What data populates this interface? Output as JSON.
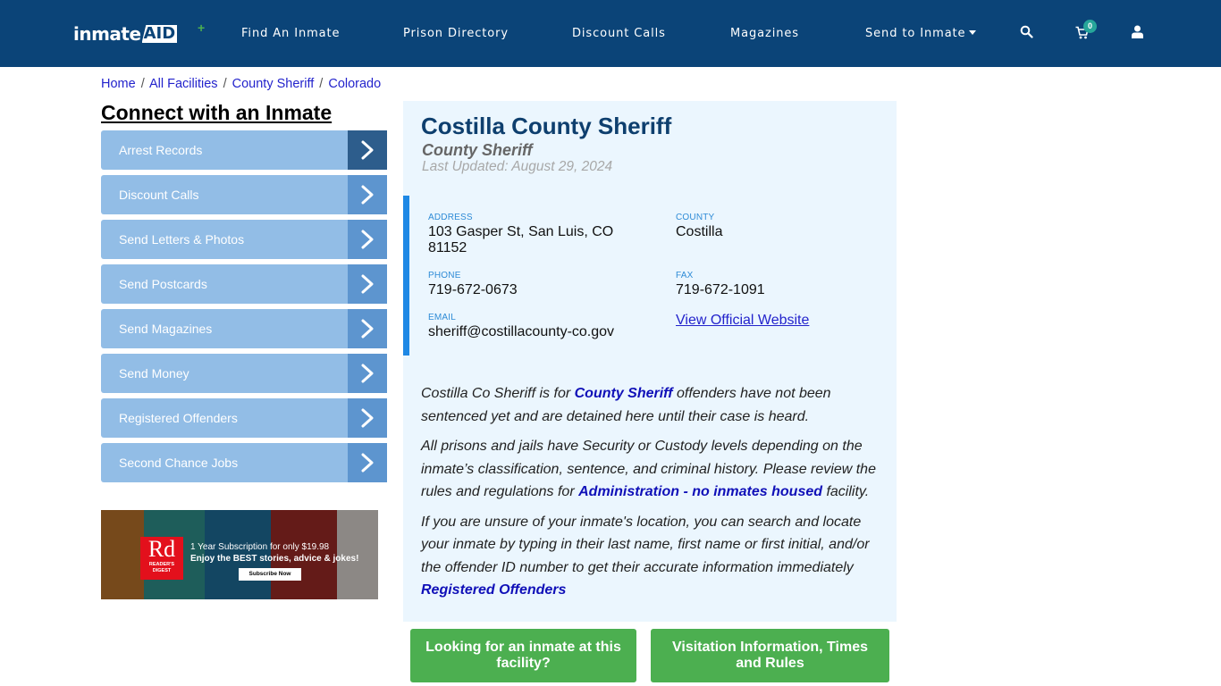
{
  "header": {
    "logo": {
      "part1": "inmate",
      "part2": "AID",
      "plus": "+"
    },
    "nav": [
      {
        "label": "Find An Inmate"
      },
      {
        "label": "Prison Directory"
      },
      {
        "label": "Discount Calls"
      },
      {
        "label": "Magazines"
      },
      {
        "label": "Send to Inmate"
      }
    ],
    "icons": {
      "search": "search-icon",
      "cart": "cart-icon",
      "user": "user-icon"
    },
    "cart_count": "0"
  },
  "breadcrumb": [
    {
      "label": "Home"
    },
    {
      "label": "All Facilities"
    },
    {
      "label": "County Sheriff"
    },
    {
      "label": "Colorado"
    }
  ],
  "breadcrumb_separator": "/",
  "sidebar": {
    "title": "Connect with an Inmate",
    "items": [
      {
        "label": "Arrest Records"
      },
      {
        "label": "Discount Calls"
      },
      {
        "label": "Send Letters & Photos"
      },
      {
        "label": "Send Postcards"
      },
      {
        "label": "Send Magazines"
      },
      {
        "label": "Send Money"
      },
      {
        "label": "Registered Offenders"
      },
      {
        "label": "Second Chance Jobs"
      }
    ]
  },
  "ad": {
    "logo_big": "Rd",
    "logo_small_1": "READER'S",
    "logo_small_2": "DIGEST",
    "line1": "1 Year Subscription for only $19.98",
    "line2": "Enjoy the BEST stories, advice & jokes!",
    "button": "Subscribe Now"
  },
  "facility": {
    "name": "Costilla County Sheriff",
    "type": "County Sheriff",
    "last_updated": "Last Updated: August 29, 2024",
    "address_label": "ADDRESS",
    "address": "103 Gasper St, San Luis, CO 81152",
    "county_label": "COUNTY",
    "county": "Costilla",
    "phone_label": "PHONE",
    "phone": "719-672-0673",
    "fax_label": "FAX",
    "fax": "719-672-1091",
    "email_label": "EMAIL",
    "email": "sheriff@costillacounty-co.gov",
    "website_link": "View Official Website"
  },
  "description": {
    "p1_a": "Costilla Co Sheriff is for ",
    "p1_link": "County Sheriff",
    "p1_b": " offenders have not been sentenced yet and are detained here until their case is heard.",
    "p2_a": "All prisons and jails have Security or Custody levels depending on the inmate’s classification, sentence, and criminal history. Please review the rules and regulations for ",
    "p2_link": "Administration - no inmates housed",
    "p2_b": " facility.",
    "p3_a": "If you are unsure of your inmate's location, you can search and locate your inmate by typing in their last name, first name or first initial, and/or the offender ID number to get their accurate information immediately ",
    "p3_link": "Registered Offenders"
  },
  "buttons": {
    "looking": "Looking for an inmate at this facility?",
    "visitation": "Visitation Information, Times and Rules"
  }
}
